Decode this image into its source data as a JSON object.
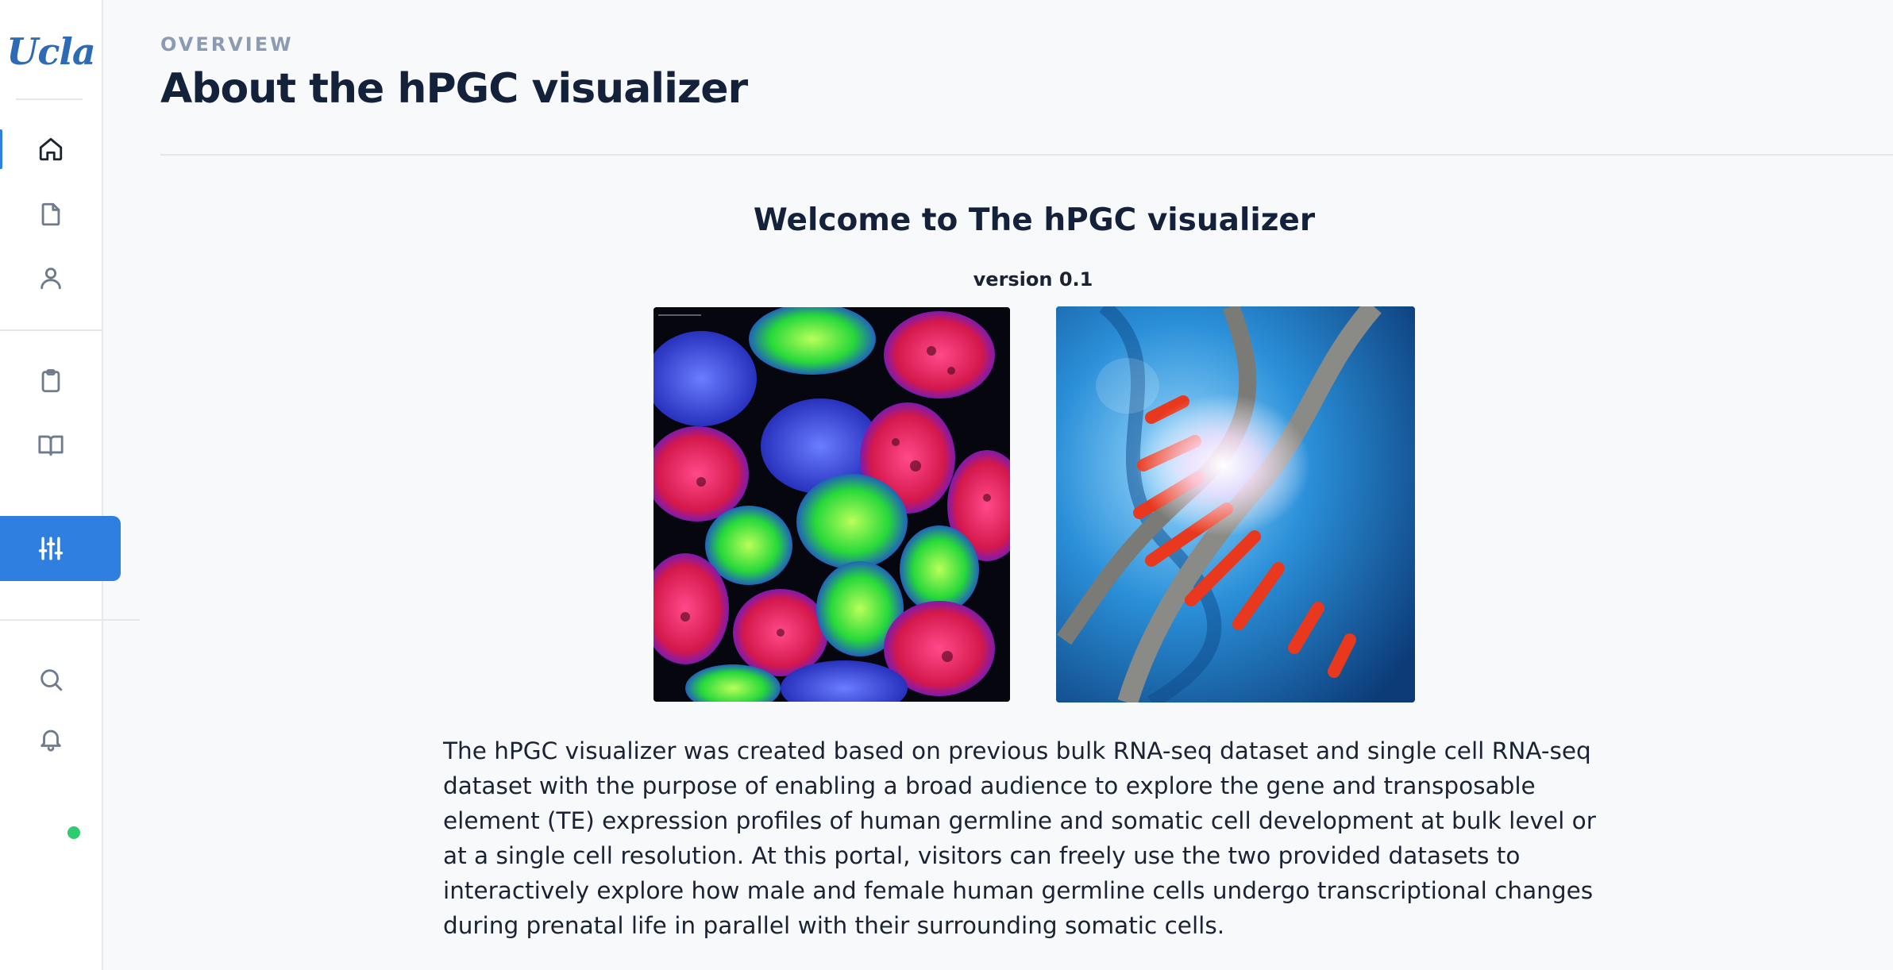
{
  "sidebar": {
    "logo": "Ucla",
    "items": [
      {
        "name": "home",
        "icon": "home-icon"
      },
      {
        "name": "documents",
        "icon": "file-icon"
      },
      {
        "name": "profile",
        "icon": "user-icon"
      },
      {
        "name": "clipboard",
        "icon": "clipboard-icon"
      },
      {
        "name": "book",
        "icon": "book-open-icon"
      },
      {
        "name": "settings",
        "icon": "sliders-icon"
      },
      {
        "name": "search",
        "icon": "search-icon"
      },
      {
        "name": "notifications",
        "icon": "bell-icon"
      }
    ],
    "status_color": "#2ecc71",
    "accent_color": "#2f7fe0"
  },
  "header": {
    "eyebrow": "OVERVIEW",
    "title": "About the hPGC visualizer"
  },
  "main": {
    "heading": "Welcome to The hPGC visualizer",
    "version": "version 0.1",
    "description": "The hPGC visualizer was created based on previous bulk RNA-seq dataset and single cell RNA-seq dataset with the purpose of enabling a broad audience to explore the gene and transposable element (TE) expression profiles of human germline and somatic cell development at bulk level or at a single cell resolution. At this portal, visitors can freely use the two provided datasets to interactively explore how male and female human germline cells undergo transcriptional changes during prenatal life in parallel with their surrounding somatic cells."
  }
}
